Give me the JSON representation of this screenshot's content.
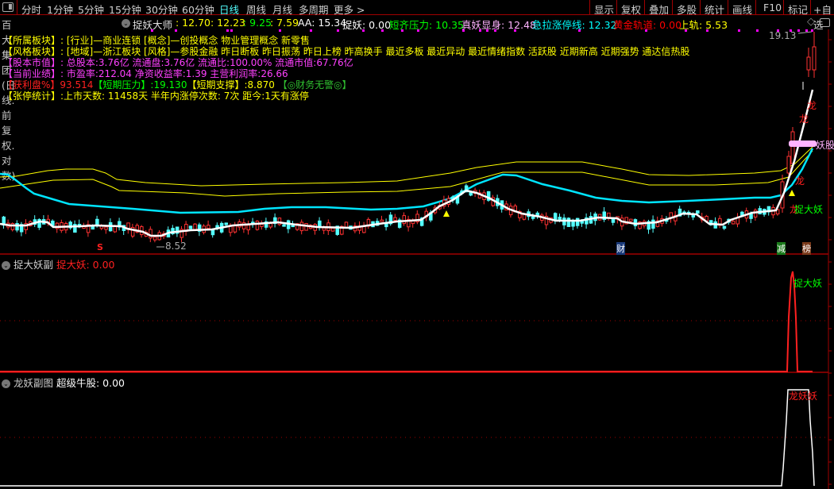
{
  "menu": {
    "periods": [
      "分时",
      "1分钟",
      "5分钟",
      "15分钟",
      "30分钟",
      "60分钟",
      "日线",
      "周线",
      "月线",
      "多周期",
      "更多 >"
    ],
    "active": "日线",
    "right": [
      "显示",
      "复权",
      "叠加",
      "多股",
      "统计",
      "画线",
      "F10",
      "标记",
      "+自选"
    ]
  },
  "info": {
    "title": "百大集团(日线.前复权.对数)",
    "indicator": "捉妖大师",
    "v1": ": 12.70",
    "v2": ": 12.23",
    "v3": ": 9.25",
    "v4": ": 7.59",
    "aa": "AA: 15.34",
    "zy": "捉妖: 0.00",
    "dq": "短齐压力: 10.35",
    "zy2": "真妖显身: 12.48",
    "jl": "急拉涨停线: 12.32",
    "hj": "黄金轨道: 0.00",
    "sg": "上轨: 5.53"
  },
  "fundamentals": {
    "l1k": "【所属板块】:",
    "l1v": "[行业]—商业连锁 [概念]—创投概念 物业管理概念 新零售",
    "l2k": "【风格板块】:",
    "l2v": "[地域]—浙江板块 [风格]—参股金融 昨日断板 昨日振荡 昨日上榜 昨高换手 最近多板 最近异动 最近情绪指数 活跃股 近期新高 近期强势 通达信热股",
    "l3k": "【股本市值】:",
    "l3v": "总股本:3.76亿 流通盘:3.76亿 流通比:100.00% 流通市值:67.76亿",
    "l4k": "【当前业绩】:",
    "l4v": "市盈率:212.04 净资收益率:1.39 主营利润率:26.66",
    "l5a": "【获利盘%】",
    "l5b": "93.514",
    "l5c": "【短期压力】",
    "l5d": ":19.130",
    "l5e": "【短期支撑】",
    "l5f": ":8.870",
    "l5g": "【◎财务无警◎】",
    "l6k": "【张停统计】",
    "l6v": ":上市天数: 11458天 半年内涨停次数: 7次 距今:1天有涨停"
  },
  "chart": {
    "high_label": "19.13",
    "low_label": "8.52",
    "yao_label": "妖股",
    "long": "龙",
    "zdy": "捉大妖",
    "cai": "财",
    "jian": "减",
    "bang": "榜",
    "s_mark": "S"
  },
  "pane1": {
    "name": "捉大妖副",
    "series": "捉大妖: 0.00",
    "label": "捉大妖"
  },
  "pane2": {
    "name": "龙妖副图",
    "series": "超级牛股: 0.00",
    "label": "龙妖妖"
  },
  "colors": {
    "up": "#ff3232",
    "down": "#54ffff",
    "ma": "#ffffff",
    "band": "#ffff00",
    "cyan": "#00e5ff",
    "border": "#a00000"
  }
}
